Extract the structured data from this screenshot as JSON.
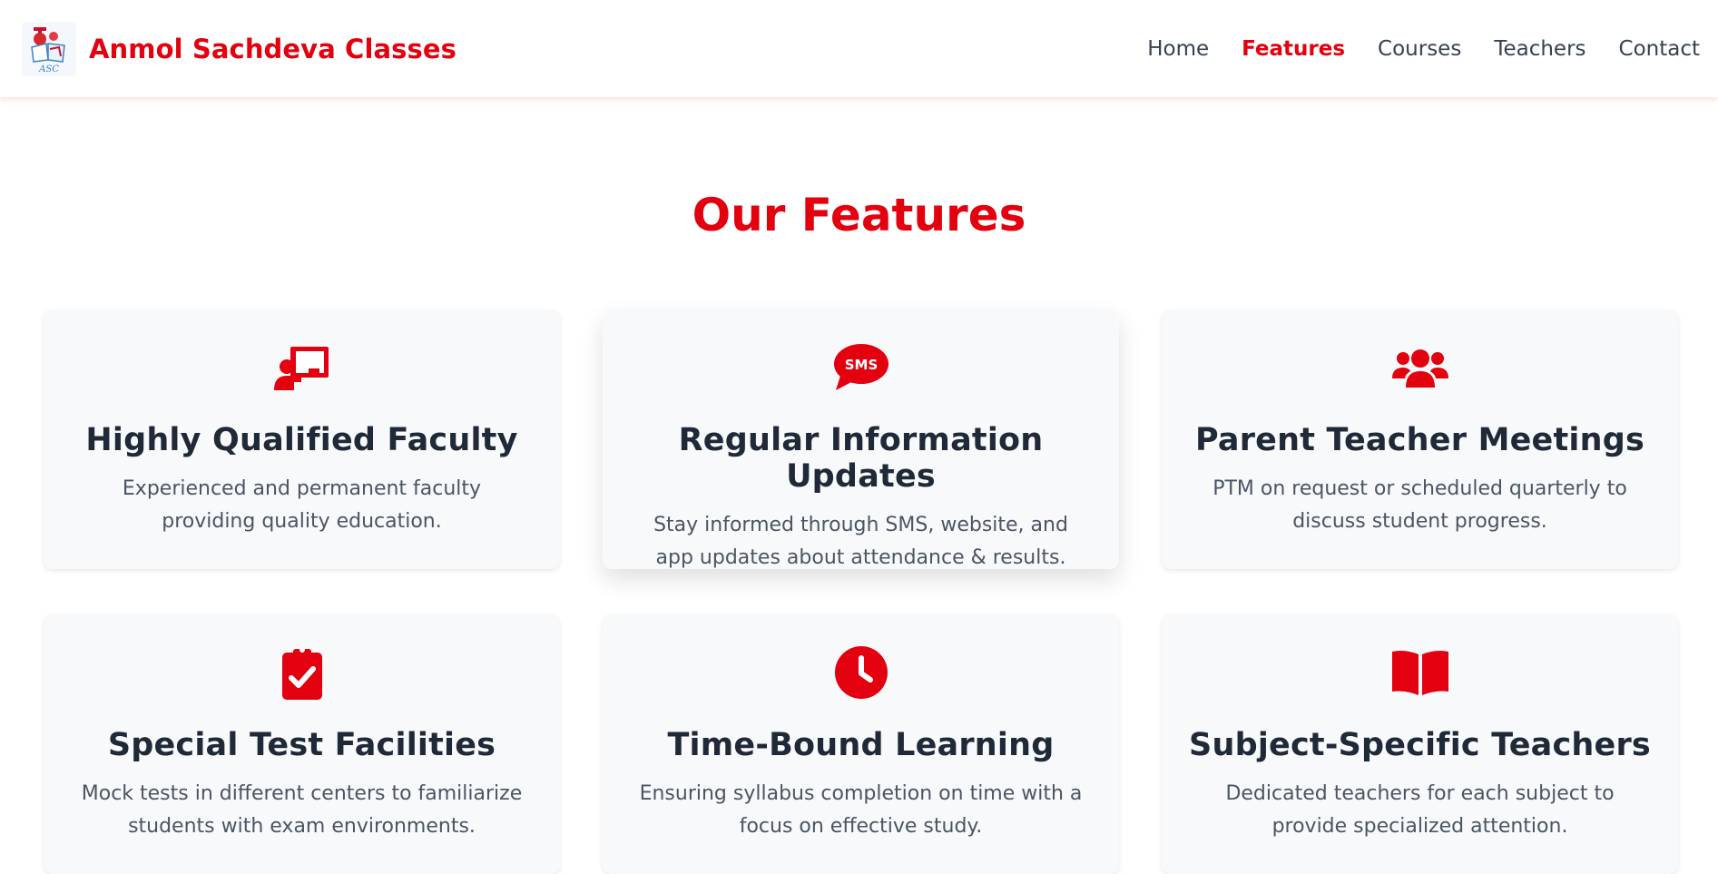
{
  "brand": {
    "name": "Anmol Sachdeva Classes",
    "logo_text": "ASC"
  },
  "nav": {
    "items": [
      {
        "label": "Home",
        "active": false
      },
      {
        "label": "Features",
        "active": true
      },
      {
        "label": "Courses",
        "active": false
      },
      {
        "label": "Teachers",
        "active": false
      },
      {
        "label": "Contact",
        "active": false
      }
    ]
  },
  "features": {
    "title": "Our Features",
    "cards": [
      {
        "icon": "chalkboard-teacher-icon",
        "title": "Highly Qualified Faculty",
        "desc": "Experienced and permanent faculty providing quality education."
      },
      {
        "icon": "sms-icon",
        "title": "Regular Information Updates",
        "desc": "Stay informed through SMS, website, and app updates about attendance & results."
      },
      {
        "icon": "users-icon",
        "title": "Parent Teacher Meetings",
        "desc": "PTM on request or scheduled quarterly to discuss student progress."
      },
      {
        "icon": "clipboard-check-icon",
        "title": "Special Test Facilities",
        "desc": "Mock tests in different centers to familiarize students with exam environments."
      },
      {
        "icon": "clock-icon",
        "title": "Time-Bound Learning",
        "desc": "Ensuring syllabus completion on time with a focus on effective study."
      },
      {
        "icon": "book-open-icon",
        "title": "Subject-Specific Teachers",
        "desc": "Dedicated teachers for each subject to provide specialized attention."
      }
    ]
  },
  "colors": {
    "accent": "#e3000f",
    "heading": "#1f2937",
    "body_text": "#4b5563",
    "card_bg": "#f8f9fb"
  }
}
